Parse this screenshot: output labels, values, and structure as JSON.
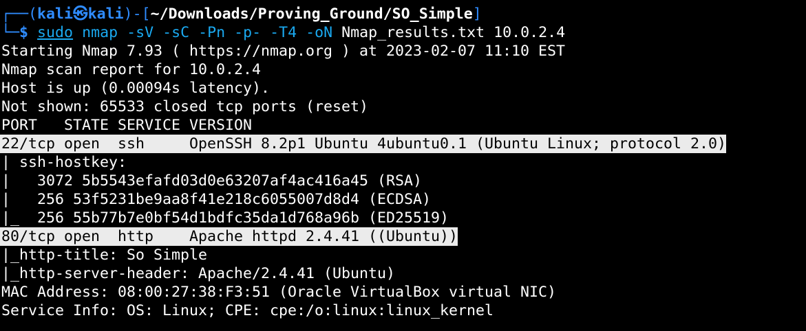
{
  "prompt": {
    "line1_prefix": "┌──(",
    "user": "kali",
    "at_symbol": "㉿",
    "host": "kali",
    "sep": ")-[",
    "path": "~/Downloads/Proving_Ground/SO_Simple",
    "close": "]",
    "line2_prefix": "└─",
    "dollar": "$",
    "sudo": "sudo",
    "command": "nmap",
    "args": "-sV -sC -Pn -p- -T4 -oN",
    "rest": "Nmap_results.txt 10.0.2.4"
  },
  "output": [
    "Starting Nmap 7.93 ( https://nmap.org ) at 2023-02-07 11:10 EST",
    "Nmap scan report for 10.0.2.4",
    "Host is up (0.00094s latency).",
    "Not shown: 65533 closed tcp ports (reset)",
    "PORT   STATE SERVICE VERSION",
    "22/tcp open  ssh     OpenSSH 8.2p1 Ubuntu 4ubuntu0.1 (Ubuntu Linux; protocol 2.0)",
    "| ssh-hostkey: ",
    "|   3072 5b5543efafd03d0e63207af4ac416a45 (RSA)",
    "|   256 53f5231be9aa8f41e218c6055007d8d4 (ECDSA)",
    "|_  256 55b77b7e0bf54d1bdfc35da1d768a96b (ED25519)",
    "80/tcp open  http    Apache httpd 2.4.41 ((Ubuntu))",
    "|_http-title: So Simple",
    "|_http-server-header: Apache/2.4.41 (Ubuntu)",
    "MAC Address: 08:00:27:38:F3:51 (Oracle VirtualBox virtual NIC)",
    "Service Info: OS: Linux; CPE: cpe:/o:linux:linux_kernel"
  ],
  "colors": {
    "background": "#000000",
    "prompt_frame": "#2f8cff",
    "user_host": "#2f8cff",
    "dollar": "#2f8cff",
    "command": "#1aa9f0",
    "highlight_bg": "#ebebeb"
  }
}
